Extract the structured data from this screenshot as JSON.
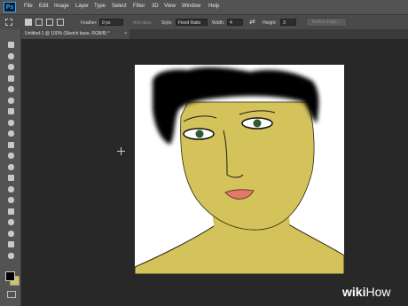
{
  "app": {
    "logo": "Ps"
  },
  "menu": [
    "File",
    "Edit",
    "Image",
    "Layer",
    "Type",
    "Select",
    "Filter",
    "3D",
    "View",
    "Window",
    "Help"
  ],
  "options": {
    "feather_label": "Feather:",
    "feather_value": "0 px",
    "antialias_label": "Anti-alias",
    "style_label": "Style:",
    "style_value": "Fixed Ratio",
    "width_label": "Width:",
    "width_value": "4",
    "height_label": "Height:",
    "height_value": "3",
    "refine_edge": "Refine Edge..."
  },
  "document": {
    "tab_title": "Untitled-1 @ 100% (Sketch base, RGB/8) *",
    "close_glyph": "×"
  },
  "tools": [
    "move-tool",
    "marquee-tool",
    "lasso-tool",
    "quick-select-tool",
    "crop-tool",
    "eyedropper-tool",
    "healing-tool",
    "brush-tool",
    "clone-stamp-tool",
    "history-brush-tool",
    "eraser-tool",
    "gradient-tool",
    "blur-tool",
    "dodge-tool",
    "pen-tool",
    "type-tool",
    "path-select-tool",
    "shape-tool",
    "hand-tool",
    "zoom-tool"
  ],
  "colors": {
    "foreground": "#000000",
    "background": "#d4c25a",
    "skin": "#d4c25a",
    "hair": "#000000",
    "lips": "#e07a6a"
  },
  "watermark": {
    "wiki": "wiki",
    "how": "How"
  }
}
